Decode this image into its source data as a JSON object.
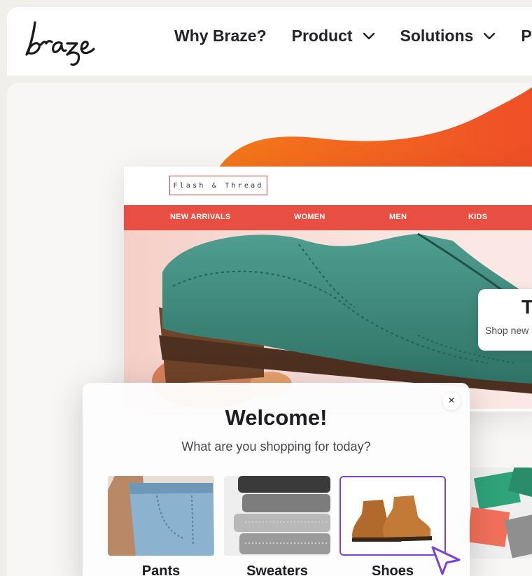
{
  "header": {
    "logo_text": "braze",
    "nav": [
      {
        "label": "Why Braze?",
        "has_dropdown": false
      },
      {
        "label": "Product",
        "has_dropdown": true
      },
      {
        "label": "Solutions",
        "has_dropdown": true
      },
      {
        "label": "P",
        "has_dropdown": false
      }
    ]
  },
  "site": {
    "brand": "Flash & Thread",
    "nav": [
      "NEW ARRIVALS",
      "WOMEN",
      "MEN",
      "KIDS"
    ],
    "promo_title": "T",
    "promo_sub": "Shop new"
  },
  "modal": {
    "close_glyph": "×",
    "title": "Welcome!",
    "subtitle": "What are you shopping for today?",
    "options": [
      {
        "label": "Pants",
        "selected": false
      },
      {
        "label": "Sweaters",
        "selected": false
      },
      {
        "label": "Shoes",
        "selected": true
      }
    ]
  },
  "colors": {
    "accent_orange": "#f05a1e",
    "site_nav_red": "#e84e41",
    "selection_purple": "#7f3fd1",
    "text_dark": "#23232b"
  },
  "icons": [
    "chevron-down-icon",
    "close-icon",
    "cursor-pointer-icon"
  ]
}
